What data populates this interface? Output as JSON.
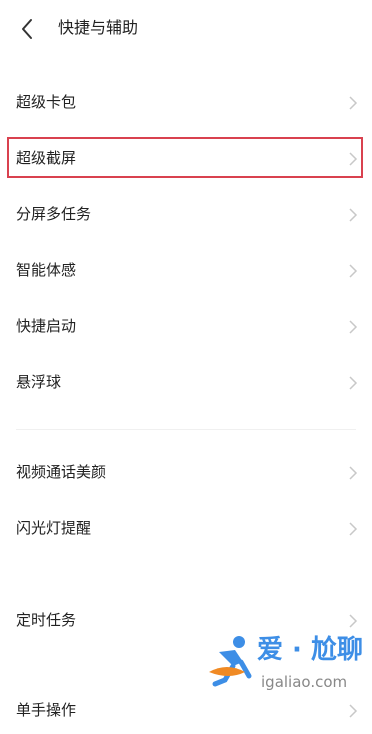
{
  "header": {
    "back_icon": "chevron-left-icon",
    "title": "快捷与辅助"
  },
  "menu": {
    "items": [
      {
        "label": "超级卡包"
      },
      {
        "label": "超级截屏",
        "highlighted": true
      },
      {
        "label": "分屏多任务"
      },
      {
        "label": "智能体感"
      },
      {
        "label": "快捷启动"
      },
      {
        "label": "悬浮球"
      },
      {
        "label": "视频通话美颜"
      },
      {
        "label": "闪光灯提醒"
      },
      {
        "label": "定时任务"
      },
      {
        "label": "单手操作"
      }
    ]
  },
  "watermark": {
    "title": "爱 · 尬聊",
    "subtitle": "igaliao.com"
  },
  "colors": {
    "highlight_border": "#d9414f",
    "chevron": "#c8c8c8",
    "watermark_blue": "#3d8ee6",
    "watermark_orange": "#f08a24"
  }
}
